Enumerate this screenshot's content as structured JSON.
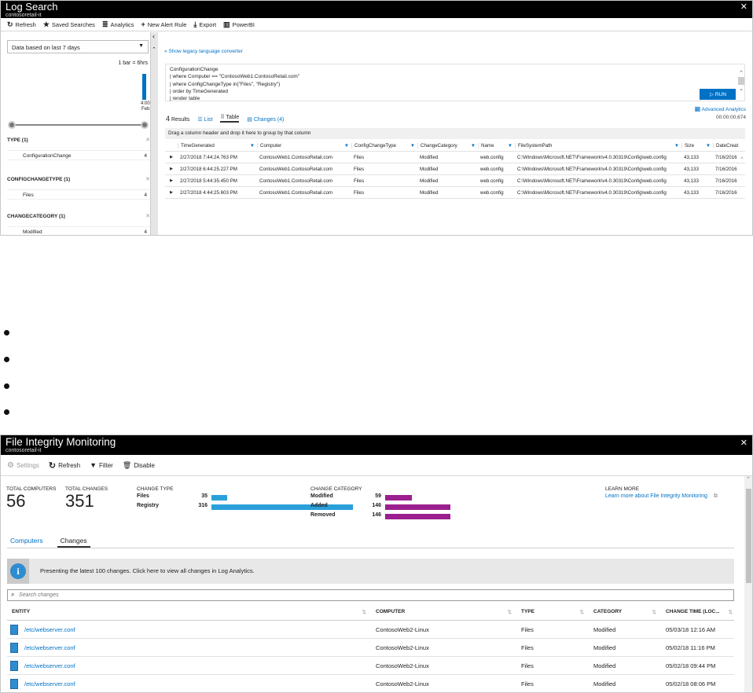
{
  "log": {
    "title": "Log Search",
    "subtitle": "contosoretail-it",
    "close": "✕",
    "commands": [
      {
        "icon": "↻",
        "label": "Refresh"
      },
      {
        "icon": "★",
        "label": "Saved Searches"
      },
      {
        "icon": "≣",
        "label": "Analytics"
      },
      {
        "icon": "+",
        "label": "New Alert Rule"
      },
      {
        "icon": "⤓",
        "label": "Export"
      },
      {
        "icon": "▥",
        "label": "PowerBI"
      }
    ],
    "collapse": "‹",
    "date_select": "Data based on last 7 days",
    "bar_caption": "1 bar = 6hrs",
    "bar_time": "4:00",
    "bar_month": "Feb",
    "facets": [
      {
        "title": "TYPE (1)",
        "item": "ConfigurationChange",
        "count": "4"
      },
      {
        "title": "CONFIGCHANGETYPE (1)",
        "item": "Files",
        "count": "4"
      },
      {
        "title": "CHANGECATEGORY (1)",
        "item": "Modified",
        "count": "4"
      }
    ],
    "legacy_link": "Show legacy language converter",
    "query_lines": [
      "ConfigurationChange",
      "| where Computer == \"ContosoWeb1.ContosoRetail.com\"",
      "| where ConfigChangeType in(\"Files\", \"Registry\")",
      "| order by TimeGenerated",
      "| render table"
    ],
    "run_label": "RUN",
    "advanced": "Advanced Analytics",
    "elapsed": "00:00:00.674",
    "results_count": "4",
    "results_label": "Results",
    "view_tabs": [
      "List",
      "Table",
      "Changes (4)"
    ],
    "group_hint": "Drag a column header and drop it here to group by that column",
    "columns": [
      "TimeGenerated",
      "Computer",
      "ConfigChangeType",
      "ChangeCategory",
      "Name",
      "FileSystemPath",
      "Size",
      "DateCreat"
    ],
    "rows": [
      [
        "2/27/2018 7:44:24.763 PM",
        "ContosoWeb1.ContosoRetail.com",
        "Files",
        "Modified",
        "web.config",
        "C:\\Windows\\Microsoft.NET\\Framework\\v4.0.30319\\Config\\web.config",
        "43,133",
        "7/16/2016"
      ],
      [
        "2/27/2018 6:44:25.227 PM",
        "ContosoWeb1.ContosoRetail.com",
        "Files",
        "Modified",
        "web.config",
        "C:\\Windows\\Microsoft.NET\\Framework\\v4.0.30319\\Config\\web.config",
        "43,133",
        "7/16/2016"
      ],
      [
        "2/27/2018 5:44:35.450 PM",
        "ContosoWeb1.ContosoRetail.com",
        "Files",
        "Modified",
        "web.config",
        "C:\\Windows\\Microsoft.NET\\Framework\\v4.0.30319\\Config\\web.config",
        "43,133",
        "7/16/2016"
      ],
      [
        "2/27/2018 4:44:25.603 PM",
        "ContosoWeb1.ContosoRetail.com",
        "Files",
        "Modified",
        "web.config",
        "C:\\Windows\\Microsoft.NET\\Framework\\v4.0.30319\\Config\\web.config",
        "43,133",
        "7/16/2016"
      ]
    ]
  },
  "fim": {
    "title": "File Integrity Monitoring",
    "subtitle": "contosoretail-it",
    "close": "✕",
    "commands": [
      {
        "icon": "⚙",
        "label": "Settings"
      },
      {
        "icon": "↻",
        "label": "Refresh"
      },
      {
        "icon": "▼",
        "label": "Filter"
      },
      {
        "icon": "🗑",
        "label": "Disable"
      }
    ],
    "total_computers_label": "TOTAL COMPUTERS",
    "total_computers": "56",
    "total_changes_label": "TOTAL CHANGES",
    "total_changes": "351",
    "change_type": {
      "title": "CHANGE TYPE",
      "color": "#2aa0da",
      "items": [
        {
          "label": "Files",
          "value": 35
        },
        {
          "label": "Registry",
          "value": 316
        }
      ]
    },
    "change_category": {
      "title": "CHANGE CATEGORY",
      "color": "#9b1f8f",
      "items": [
        {
          "label": "Modified",
          "value": 59
        },
        {
          "label": "Added",
          "value": 146
        },
        {
          "label": "Removed",
          "value": 146
        }
      ]
    },
    "learn_title": "LEARN MORE",
    "learn_link": "Learn more about File Integrity Monitoring",
    "tabs": [
      "Computers",
      "Changes"
    ],
    "info_text": "Presenting the latest 100 changes. Click here to view all changes in Log Analytics.",
    "search_placeholder": "Search changes",
    "columns": [
      "ENTITY",
      "COMPUTER",
      "TYPE",
      "CATEGORY",
      "CHANGE TIME (LOC..."
    ],
    "rows": [
      [
        "/etc/webserver.conf",
        "ContosoWeb2-Linux",
        "Files",
        "Modified",
        "05/03/18 12:16 AM"
      ],
      [
        "/etc/webserver.conf",
        "ContosoWeb2-Linux",
        "Files",
        "Modified",
        "05/02/18 11:16 PM"
      ],
      [
        "/etc/webserver.conf",
        "ContosoWeb2-Linux",
        "Files",
        "Modified",
        "05/02/18 09:44 PM"
      ],
      [
        "/etc/webserver.conf",
        "ContosoWeb2-Linux",
        "Files",
        "Modified",
        "05/02/18 08:06 PM"
      ]
    ]
  }
}
